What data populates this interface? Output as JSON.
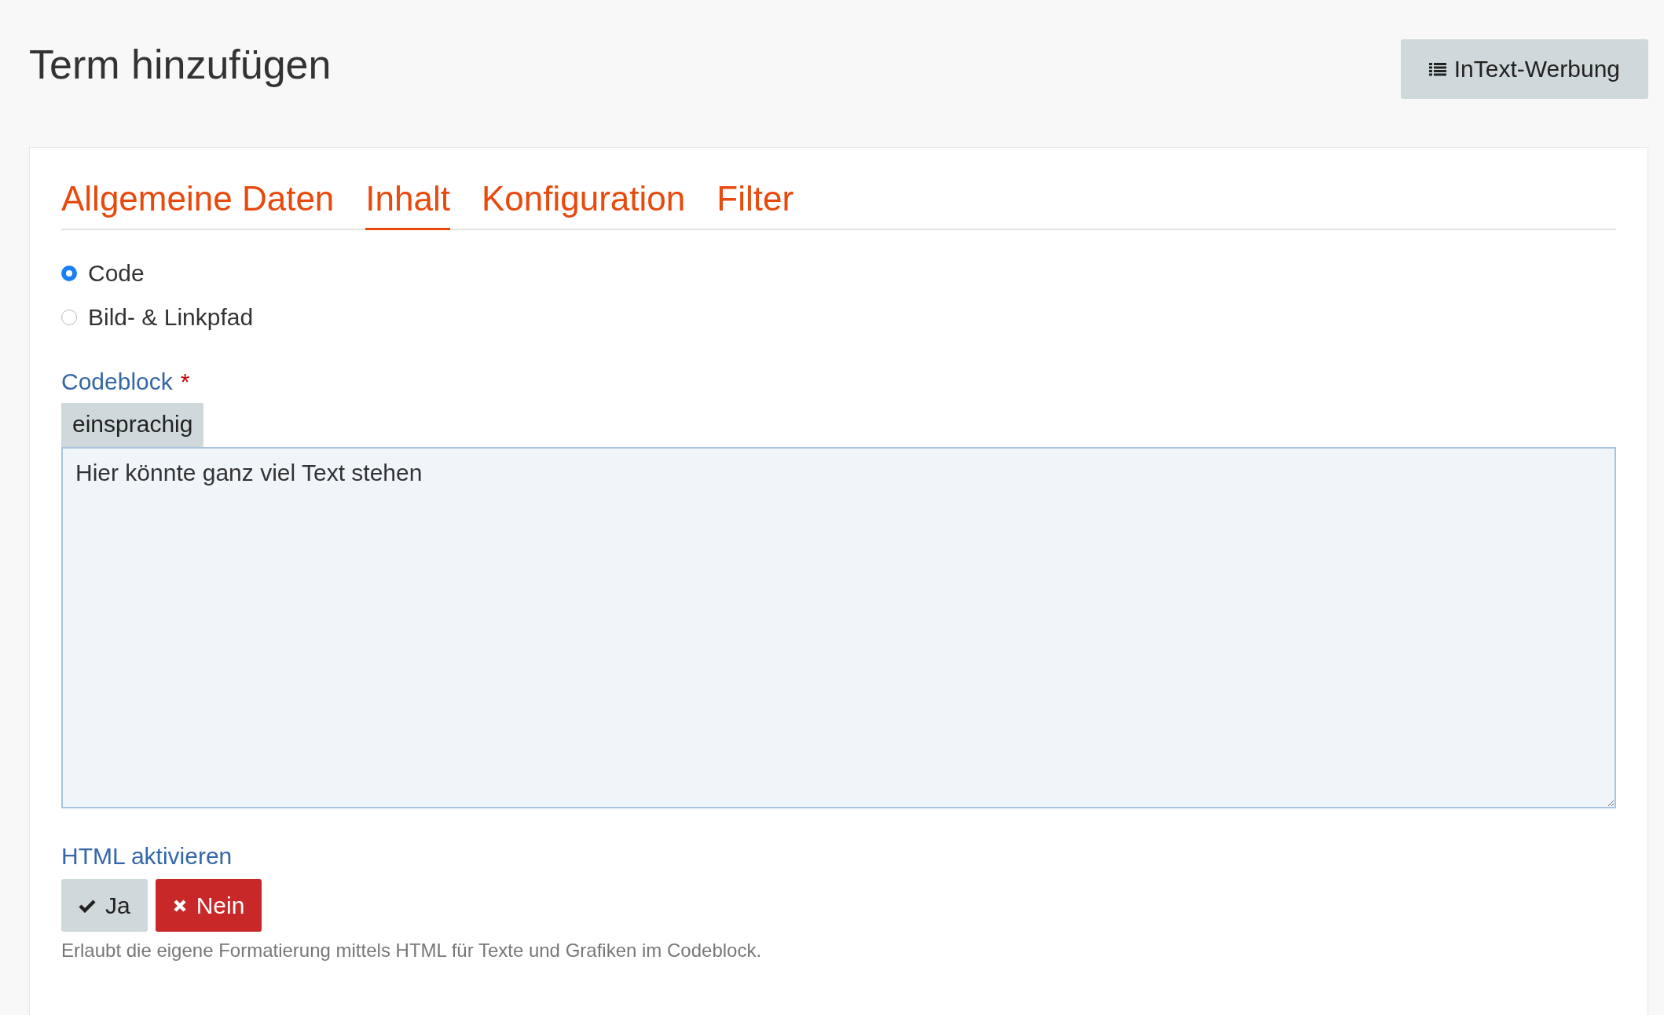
{
  "page_title": "Term hinzufügen",
  "header_button": {
    "label": "InText-Werbung"
  },
  "tabs": [
    {
      "label": "Allgemeine Daten",
      "selected": false
    },
    {
      "label": "Inhalt",
      "selected": true
    },
    {
      "label": "Konfiguration",
      "selected": false
    },
    {
      "label": "Filter",
      "selected": false
    }
  ],
  "content_type": [
    {
      "label": "Code",
      "selected": true
    },
    {
      "label": "Bild- & Linkpfad",
      "selected": false
    }
  ],
  "codeblock": {
    "label": "Codeblock",
    "required_mark": "*",
    "language_tab": "einsprachig",
    "value": "Hier könnte ganz viel Text stehen"
  },
  "html_toggle": {
    "label": "HTML aktivieren",
    "options": [
      {
        "kind": "yes",
        "label": "Ja",
        "selected": false
      },
      {
        "kind": "no",
        "label": "Nein",
        "selected": true
      }
    ],
    "help": "Erlaubt die eigene Formatierung mittels HTML für Texte und Grafiken im Codeblock."
  }
}
